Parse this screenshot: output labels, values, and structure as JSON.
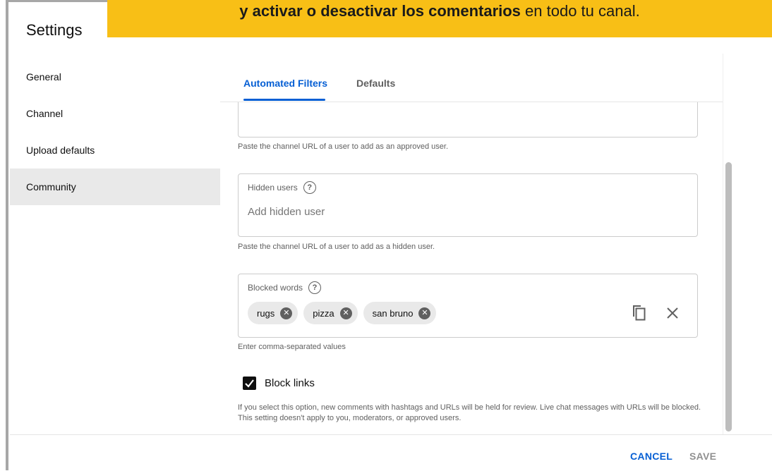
{
  "banner": {
    "bold_text": "y activar o desactivar los comentarios",
    "normal_text": " en todo tu canal."
  },
  "title": "Settings",
  "sidebar": {
    "items": [
      {
        "label": "General"
      },
      {
        "label": "Channel"
      },
      {
        "label": "Upload defaults"
      },
      {
        "label": "Community",
        "active": true
      }
    ]
  },
  "tabs": [
    {
      "label": "Automated Filters",
      "active": true
    },
    {
      "label": "Defaults"
    }
  ],
  "approved_users": {
    "helper": "Paste the channel URL of a user to add as an approved user."
  },
  "hidden_users": {
    "label": "Hidden users",
    "placeholder": "Add hidden user",
    "helper": "Paste the channel URL of a user to add as a hidden user."
  },
  "blocked_words": {
    "label": "Blocked words",
    "chips": [
      "rugs",
      "pizza",
      "san bruno"
    ],
    "helper": "Enter comma-separated values"
  },
  "block_links": {
    "label": "Block links",
    "checked": true,
    "description": "If you select this option, new comments with hashtags and URLs will be held for review. Live chat messages with URLs will be blocked. This setting doesn't apply to you, moderators, or approved users."
  },
  "footer": {
    "cancel_label": "CANCEL",
    "save_label": "SAVE"
  },
  "colors": {
    "banner": "#f8bf16",
    "accent": "#065fd4",
    "active_item": "#e9e9e9"
  },
  "icons": {
    "help": "help-circle-icon",
    "chip_remove": "cancel-circle-icon",
    "copy": "copy-icon",
    "clear": "close-icon",
    "checkbox": "check-icon"
  }
}
